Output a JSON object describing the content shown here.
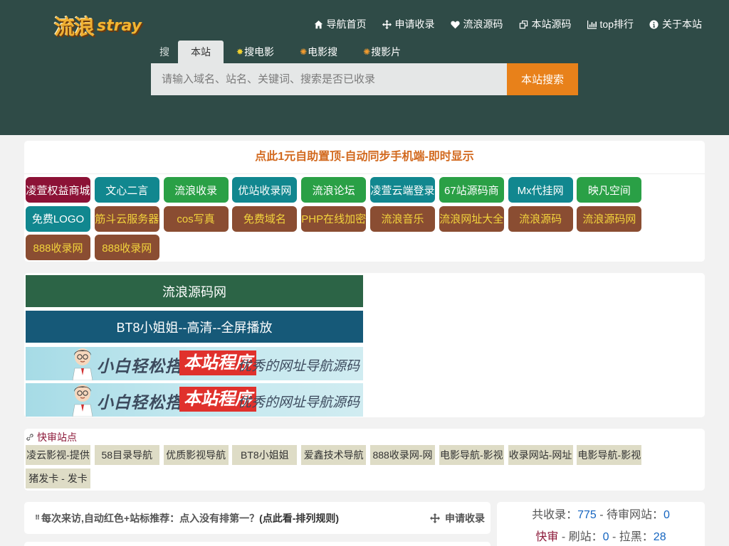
{
  "logo": {
    "cn": "流浪",
    "en": "stray"
  },
  "topnav": [
    {
      "icon": "home-icon",
      "label": "导航首页"
    },
    {
      "icon": "move-icon",
      "label": "申请收录"
    },
    {
      "icon": "heart-icon",
      "label": "流浪源码"
    },
    {
      "icon": "external-link-icon",
      "label": "本站源码"
    },
    {
      "icon": "bar-chart-icon",
      "label": "top排行"
    },
    {
      "icon": "info-circle-icon",
      "label": "关于本站"
    }
  ],
  "search": {
    "lead": "搜",
    "tabs": [
      "本站",
      "搜电影",
      "电影搜",
      "搜影片"
    ],
    "active_tab": "本站",
    "placeholder": "请输入域名、站名、关键词、搜索是否已收录",
    "value": "",
    "button": "本站搜索"
  },
  "ad": {
    "headline": "点此1元自助置顶-自动同步手机端-即时显示",
    "buttons": [
      {
        "label": "凌萱权益商城",
        "color": "maroon"
      },
      {
        "label": "文心二言",
        "color": "teal"
      },
      {
        "label": "流浪收录",
        "color": "green"
      },
      {
        "label": "优站收录网",
        "color": "teal"
      },
      {
        "label": "流浪论坛",
        "color": "green"
      },
      {
        "label": "凌萱云端登录",
        "color": "teal"
      },
      {
        "label": "67站源码商",
        "color": "green"
      },
      {
        "label": "Mx代挂网",
        "color": "teal"
      },
      {
        "label": "映凡空间",
        "color": "green"
      },
      {
        "label": "免费LOGO",
        "color": "teal"
      },
      {
        "label": "筋斗云服务器",
        "color": "brown-y"
      },
      {
        "label": "cos写真",
        "color": "brown-y"
      },
      {
        "label": "免费域名",
        "color": "brown-y"
      },
      {
        "label": "PHP在线加密",
        "color": "brown-y"
      },
      {
        "label": "流浪音乐",
        "color": "brown-y"
      },
      {
        "label": "流浪网址大全",
        "color": "brown-y"
      },
      {
        "label": "流浪源码",
        "color": "brown-y"
      },
      {
        "label": "流浪源码网",
        "color": "brown-y"
      },
      {
        "label": "888收录网",
        "color": "brown-y"
      },
      {
        "label": "888收录网",
        "color": "brown-y"
      }
    ]
  },
  "banners": {
    "text_banners": [
      "流浪源码网",
      "BT8小姐姐--高清--全屏播放"
    ],
    "image_banner": {
      "part1": "小白轻松搭建",
      "part2": "本站程序",
      "part3": "优秀的网址导航源码"
    }
  },
  "fast_review": {
    "title": "快审站点",
    "items": [
      "凌云影视-提供",
      "58目录导航",
      "优质影视导航",
      "BT8小姐姐",
      "爱鑫技术导航",
      "888收录网-网",
      "电影导航-影视",
      "收录网站-网址",
      "电影导航-影视",
      "猪发卡 - 发卡"
    ]
  },
  "notice": {
    "text": "每次来访,自动红色+站标推荐：点入没有排第一？",
    "rule_link": "(点此看-排列规则)",
    "apply": "申请收录"
  },
  "stats": {
    "total_label": "共收录：",
    "total": "775",
    "sep1": " - ",
    "pending_label": "待审网站：",
    "pending": "0",
    "fast_label": "快审",
    "sep2": " - ",
    "brush_label": "刷站：",
    "brush": "0",
    "sep3": " - ",
    "black_label": "拉黑：",
    "black": "28"
  },
  "colors": {
    "header_bg": "#2f4b47",
    "accent_orange": "#e8811a",
    "headline_orange": "#d2691e",
    "maroon": "#8c1236",
    "teal": "#11878f",
    "green": "#2aa046",
    "brown": "#8a4d32",
    "number_blue": "#1565c0"
  }
}
